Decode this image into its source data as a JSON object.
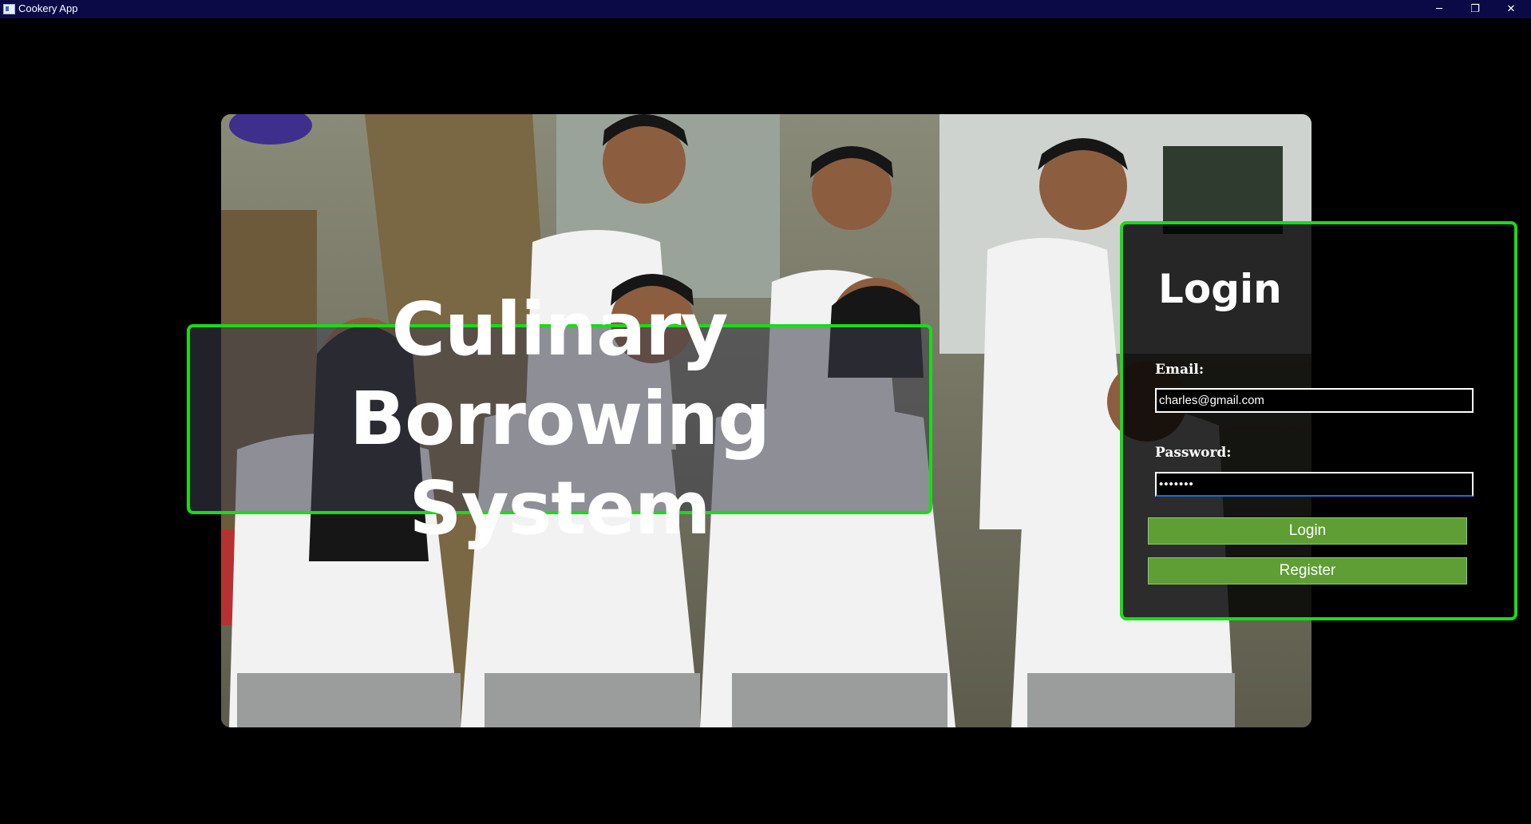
{
  "window": {
    "title": "Cookery App",
    "minimize": "─",
    "maximize": "❐",
    "close": "✕"
  },
  "hero": {
    "headline": "Culinary Borrowing\nSystem"
  },
  "login": {
    "title": "Login",
    "email_label": "Email:",
    "email_value": "charles@gmail.com",
    "password_label": "Password:",
    "password_value": "•••••••",
    "login_button": "Login",
    "register_button": "Register"
  },
  "colors": {
    "titlebar": "#0b0a47",
    "accent_border": "#18dc18",
    "button": "#5e9e35"
  }
}
